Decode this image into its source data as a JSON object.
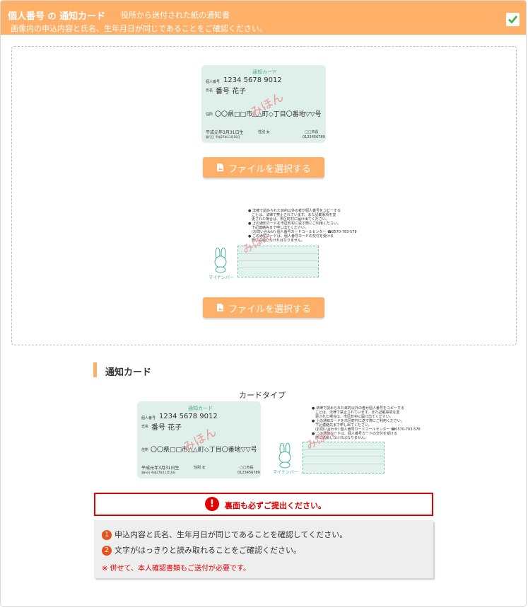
{
  "header": {
    "title_main": "個人番号",
    "title_no": "の",
    "title_rest": "通知カード",
    "subtitle": "役所から送付された紙の通知書",
    "description": "画像内の申込内容と氏名、生年月日が同じであることをご確認ください。",
    "checked": true
  },
  "card_sample": {
    "title": "通知カード",
    "number_label": "個人番号",
    "number": "1234 5678 9012",
    "name_label": "氏名",
    "name": "番号 花子",
    "address_label": "住所",
    "address": "〇〇県□□市△△町◇丁目〇番地▽▽号",
    "birth": "平成元年3月31日生",
    "sex": "性別 女",
    "issue": "発行日 平成27年11月10日",
    "office": "□□市長",
    "code": "0123456789",
    "watermark": "みほん"
  },
  "card_back": {
    "lines": [
      "● 法律で認められた目的以外の者が個人番号をコピーする",
      "ことは、法律で禁止されています。また記載事項を変",
      "更された場合は、市区町村に届け出てください。",
      "● 上の通知カードを市区町村に返す際にご利用ください。",
      "下記連絡先まで申し出てください。",
      "(お問い合わせ) 個人番号カードコールセンター  ☎0570-783-578",
      "● この通知カードは、個人番号カードの交付を受ける",
      "際に返納しなければなりません。"
    ],
    "mascot_label": "マイナンバー",
    "watermark": "みほん"
  },
  "upload": {
    "button_label_1": "ファイルを選択する",
    "button_label_2": "ファイルを選択する"
  },
  "section": {
    "title": "通知カード",
    "card_type_label": "カードタイプ"
  },
  "alert": {
    "icon": "!",
    "text": "裏面も必ずご提出ください。"
  },
  "notes": {
    "items": [
      {
        "num": "1",
        "text": "申込内容と氏名、生年月日が同じであることを確認してください。"
      },
      {
        "num": "2",
        "text": "文字がはっきりと読み取れることをご確認ください。"
      }
    ],
    "warning": "※ 併せて、本人確認書類もご送付が必要です。"
  },
  "colors": {
    "accent": "#ffb068",
    "alert": "#e10000",
    "card_green": "#dfefe9",
    "note_number": "#e94e1b"
  }
}
